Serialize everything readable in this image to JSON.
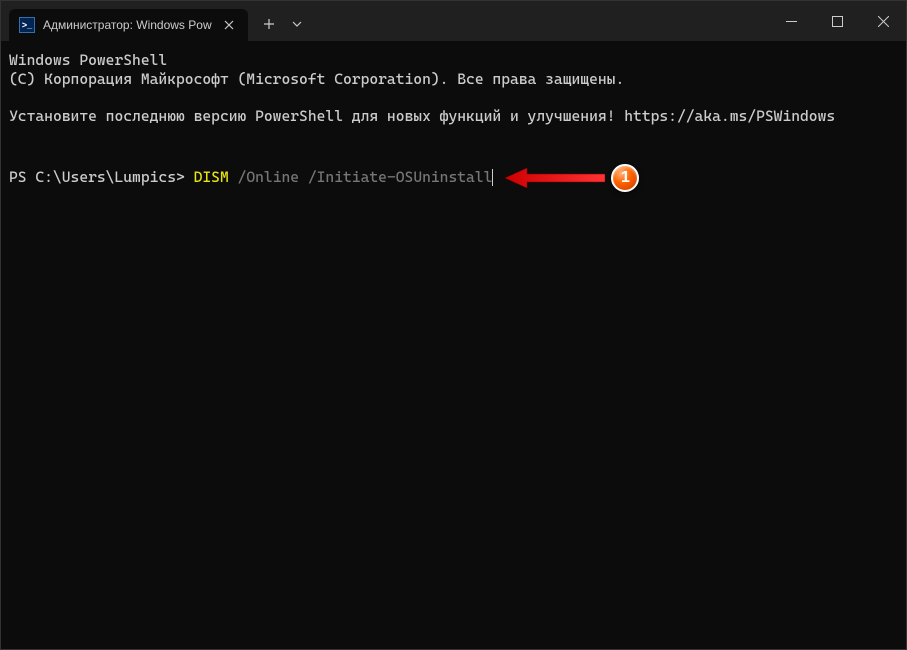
{
  "titlebar": {
    "tab_title": "Администратор: Windows Pow",
    "tab_icon_label": ">_"
  },
  "terminal": {
    "line1": "Windows PowerShell",
    "line2": "(C) Корпорация Майкрософт (Microsoft Corporation). Все права защищены.",
    "line3": "Установите последнюю версию PowerShell для новых функций и улучшения! https://aka.ms/PSWindows",
    "prompt": "PS C:\\Users\\Lumpics> ",
    "cmd_yellow": "DISM",
    "cmd_rest": " /Online /Initiate-OSUninstall"
  },
  "annotation": {
    "badge": "1"
  },
  "colors": {
    "yellow": "#e5e510",
    "bg": "#0c0c0c",
    "text": "#cccccc",
    "badge_orange": "#ff6600"
  }
}
